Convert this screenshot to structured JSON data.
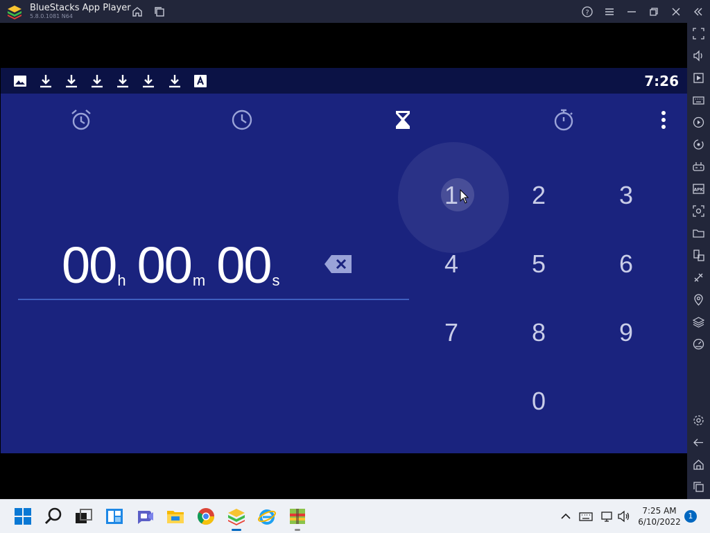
{
  "window": {
    "title": "BlueStacks App Player",
    "version": "5.8.0.1081 N64"
  },
  "statusbar": {
    "time": "7:26",
    "notification_icons": [
      "image-icon",
      "download-icon",
      "download-icon",
      "download-icon",
      "download-icon",
      "download-icon",
      "download-icon",
      "font-icon"
    ]
  },
  "clock_app": {
    "tabs": [
      {
        "name": "alarm",
        "icon": "alarm-icon",
        "selected": false
      },
      {
        "name": "clock",
        "icon": "clock-icon",
        "selected": false
      },
      {
        "name": "timer",
        "icon": "hourglass-icon",
        "selected": true
      },
      {
        "name": "stopwatch",
        "icon": "stopwatch-icon",
        "selected": false
      }
    ],
    "timer": {
      "hours": "00",
      "hours_unit": "h",
      "minutes": "00",
      "minutes_unit": "m",
      "seconds": "00",
      "seconds_unit": "s"
    },
    "keypad": [
      "1",
      "2",
      "3",
      "4",
      "5",
      "6",
      "7",
      "8",
      "9",
      "0"
    ]
  },
  "taskbar": {
    "time": "7:25 AM",
    "date": "6/10/2022",
    "notification_count": "1"
  },
  "colors": {
    "app_background": "#1a237e",
    "status_bar": "#0b1245",
    "title_bar": "#22263a",
    "accent": "#0067c0"
  }
}
